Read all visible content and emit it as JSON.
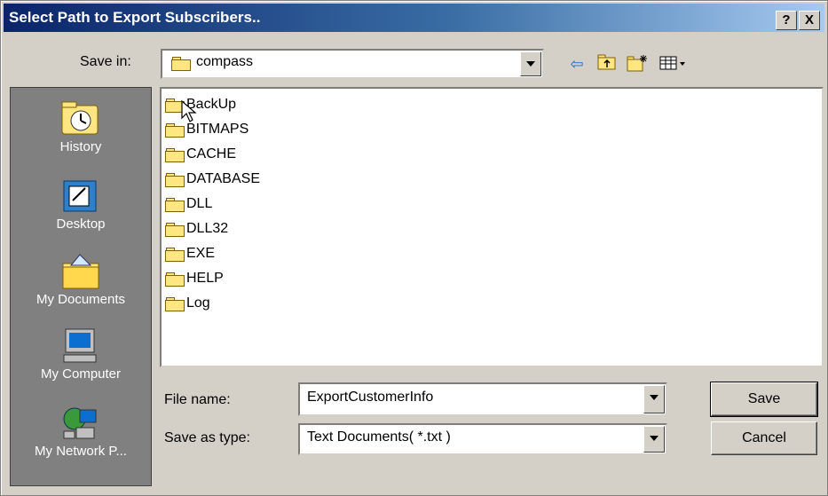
{
  "dialog": {
    "title": "Select Path to Export Subscribers..",
    "help_label": "?",
    "close_label": "X"
  },
  "save_in": {
    "label": "Save in:",
    "value": "compass"
  },
  "toolbar": {
    "back_icon": "back-arrow-icon",
    "up_icon": "up-one-level-icon",
    "new_folder_icon": "new-folder-icon",
    "view_menu_icon": "view-menu-icon"
  },
  "places": [
    {
      "label": "History",
      "icon": "history-icon"
    },
    {
      "label": "Desktop",
      "icon": "desktop-icon"
    },
    {
      "label": "My Documents",
      "icon": "my-documents-icon"
    },
    {
      "label": "My Computer",
      "icon": "my-computer-icon"
    },
    {
      "label": "My Network P...",
      "icon": "my-network-places-icon"
    }
  ],
  "files": [
    "BackUp",
    "BITMAPS",
    "CACHE",
    "DATABASE",
    "DLL",
    "DLL32",
    "EXE",
    "HELP",
    "Log"
  ],
  "file_name": {
    "label": "File name:",
    "value": "ExportCustomerInfo"
  },
  "save_as_type": {
    "label": "Save as type:",
    "value": "Text Documents( *.txt )"
  },
  "buttons": {
    "save": "Save",
    "cancel": "Cancel"
  },
  "colors": {
    "title_bar_start": "#0a246a",
    "title_bar_end": "#a6caf0",
    "dialog_face": "#d4d0c8",
    "places_bar": "#808080",
    "folder_yellow": "#ffe680"
  }
}
